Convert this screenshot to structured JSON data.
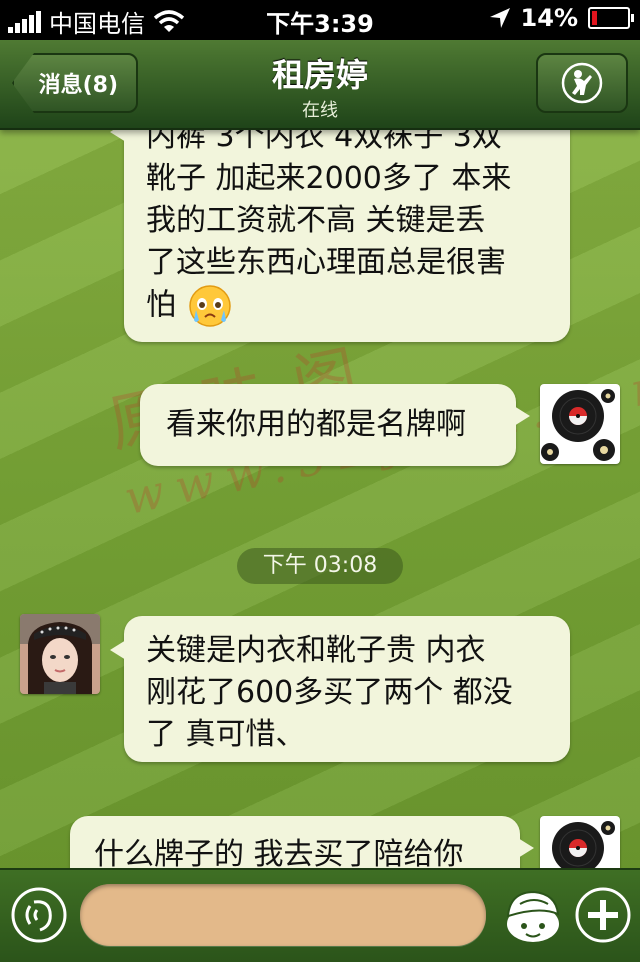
{
  "status_bar": {
    "carrier": "中国电信",
    "time": "下午3:39",
    "battery": "14%",
    "battery_level": 0.14,
    "signal_icon": "signal-bars-icon",
    "wifi_icon": "wifi-icon",
    "location_icon": "location-arrow-icon"
  },
  "nav": {
    "back_label": "消息(8)",
    "title": "租房婷",
    "subtitle": "在线",
    "profile_icon": "golfer-icon"
  },
  "messages": [
    {
      "side": "left",
      "lines": [
        "内裤 3个内衣 4双袜子 3双",
        "靴子  加起来2000多了  本来",
        "我的工资就不高  关键是丢",
        "了这些东西心理面总是很害",
        "怕"
      ],
      "emoji": "crying-face-icon"
    },
    {
      "side": "right",
      "text": "看来你用的都是名牌啊"
    },
    {
      "side": "left",
      "lines": [
        "关键是内衣和靴子贵  内衣",
        "刚花了600多买了两个  都没",
        "了  真可惜、"
      ]
    },
    {
      "side": "right",
      "text": "什么牌子的 我去买了陪给你"
    }
  ],
  "timestamp": "下午 03:08",
  "watermark": {
    "main": "原味阁",
    "url": "www.52ywei.com"
  },
  "input_bar": {
    "voice_icon": "voice-icon",
    "emoji_icon": "emoji-cap-icon",
    "plus_icon": "plus-icon"
  },
  "colors": {
    "nav_bg": "#2f5424",
    "bubble": "#f2f5dc",
    "chat_bg": "#78a536",
    "input_field": "#e3b98a"
  }
}
